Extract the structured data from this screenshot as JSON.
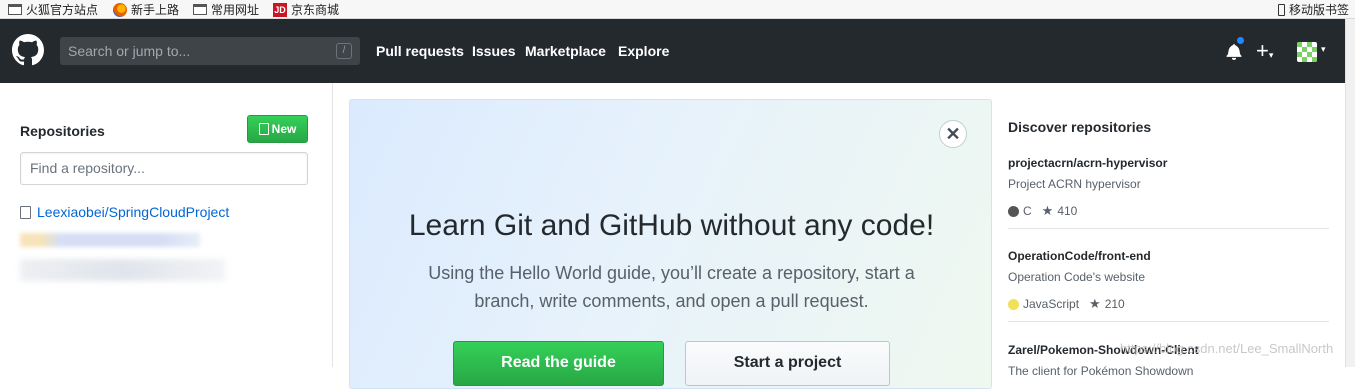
{
  "bookmarks": {
    "items": [
      {
        "label": "火狐官方站点",
        "icon": "folder-icon"
      },
      {
        "label": "新手上路",
        "icon": "firefox-icon"
      },
      {
        "label": "常用网址",
        "icon": "folder-icon"
      },
      {
        "label": "京东商城",
        "icon": "jd-icon"
      }
    ],
    "mobile": "移动版书签",
    "jd_glyph": "JD"
  },
  "header": {
    "search_placeholder": "Search or jump to...",
    "search_shortcut": "/",
    "nav": [
      "Pull requests",
      "Issues",
      "Marketplace",
      "Explore"
    ],
    "plus_glyph": "+",
    "caret_glyph": "▾"
  },
  "sidebar": {
    "title": "Repositories",
    "new_button": "New",
    "filter_placeholder": "Find a repository...",
    "repos": [
      "Leexiaobei/SpringCloudProject"
    ]
  },
  "hero": {
    "close_glyph": "✕",
    "title": "Learn Git and GitHub without any code!",
    "text": "Using the Hello World guide, you’ll create a repository, start a branch, write comments, and open a pull request.",
    "primary_button": "Read the guide",
    "secondary_button": "Start a project"
  },
  "discover": {
    "title": "Discover repositories",
    "items": [
      {
        "name": "projectacrn/acrn-hypervisor",
        "description": "Project ACRN hypervisor",
        "language": "C",
        "language_color": "#555555",
        "stars": "410"
      },
      {
        "name": "OperationCode/front-end",
        "description": "Operation Code's website",
        "language": "JavaScript",
        "language_color": "#f1e05a",
        "stars": "210"
      },
      {
        "name": "Zarel/Pokemon-Showdown-Client",
        "description": "The client for Pokémon Showdown",
        "language": "",
        "language_color": "",
        "stars": ""
      }
    ],
    "star_glyph": "★"
  },
  "watermark": "https://blog.csdn.net/Lee_SmallNorth",
  "colors": {
    "header_bg": "#24292e",
    "primary_green": "#28a745",
    "link_blue": "#0366d6"
  }
}
